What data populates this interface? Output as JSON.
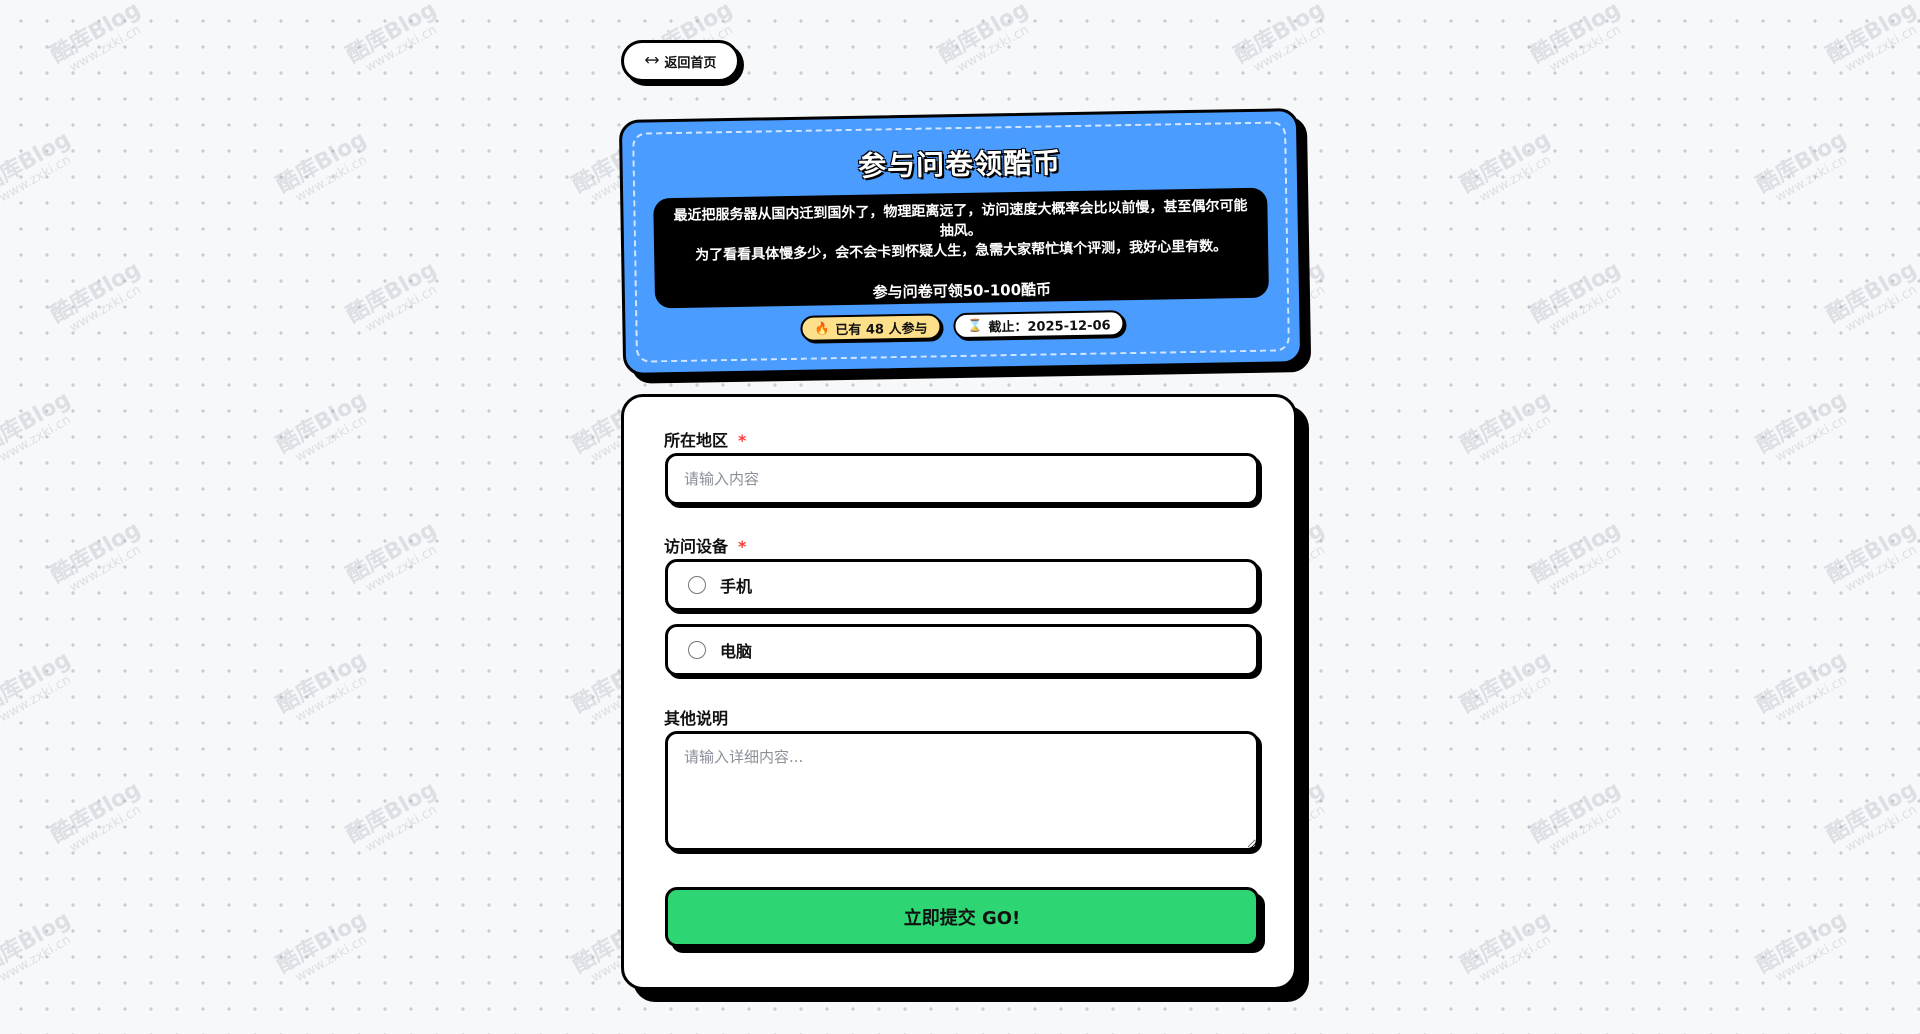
{
  "watermark": {
    "brand": "酷库Blog",
    "url": "www.zxki.cn"
  },
  "nav": {
    "back_label": "返回首页",
    "back_icon": "arrow-left-icon"
  },
  "banner": {
    "title": "参与问卷领酷币",
    "description_line1": "最近把服务器从国内迁到国外了，物理距离远了，访问速度大概率会比以前慢，甚至偶尔可能抽风。",
    "description_line2": "为了看看具体慢多少，会不会卡到怀疑人生，急需大家帮忙填个评测，我好心里有数。",
    "reward_text": "参与问卷可领50-100酷币",
    "participants_badge": "已有 48 人参与",
    "participants_icon": "fire-icon",
    "deadline_badge": "截止：2025-12-06",
    "deadline_icon": "hourglass-icon",
    "colors": {
      "banner_bg": "#4b9cff",
      "participants_bg": "#ffe08a"
    }
  },
  "form": {
    "region": {
      "label": "所在地区",
      "required_mark": "*",
      "placeholder": "请输入内容"
    },
    "device": {
      "label": "访问设备",
      "required_mark": "*",
      "options": [
        "手机",
        "电脑"
      ]
    },
    "notes": {
      "label": "其他说明",
      "placeholder": "请输入详细内容..."
    },
    "submit_label": "立即提交 GO!",
    "colors": {
      "submit_bg": "#2ed573",
      "required": "#ff3b3b"
    }
  }
}
